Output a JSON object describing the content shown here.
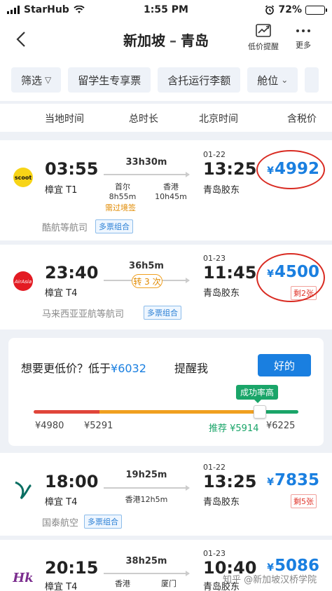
{
  "status_bar": {
    "carrier": "StarHub",
    "time": "1:55 PM",
    "battery": "72%",
    "battery_level": 0.72
  },
  "nav": {
    "origin": "新加坡",
    "separator": "–",
    "destination": "青岛",
    "price_alert_label": "低价提醒",
    "more_label": "更多"
  },
  "filters": [
    "筛选",
    "留学生专享票",
    "含托运行李额",
    "舱位"
  ],
  "columns": {
    "local_time": "当地时间",
    "duration": "总时长",
    "beijing_time": "北京时间",
    "price_incl_tax": "含税价"
  },
  "flights": [
    {
      "logo_text": "scoot",
      "dep_time": "03:55",
      "dep_airport": "樟宜 T1",
      "duration": "33h30m",
      "stops": [
        {
          "city": "首尔",
          "wait": "8h55m"
        },
        {
          "city": "香港",
          "wait": "10h45m"
        }
      ],
      "warning": "需过境签",
      "arr_date": "01-22",
      "arr_time": "13:25",
      "arr_airport": "青岛胶东",
      "airline": "酷航等航司",
      "combo": "多票组合",
      "currency": "¥",
      "price": "4992"
    },
    {
      "logo_text": "AirAsia",
      "dep_time": "23:40",
      "dep_airport": "樟宜 T4",
      "duration": "36h5m",
      "transfer": "转 3 次",
      "arr_date": "01-23",
      "arr_time": "11:45",
      "arr_airport": "青岛胶东",
      "airline": "马来西亚亚航等航司",
      "combo": "多票组合",
      "currency": "¥",
      "price": "4500",
      "seats_left": "剩2张"
    },
    {
      "dep_time": "18:00",
      "dep_airport": "樟宜 T4",
      "duration": "19h25m",
      "stop_text": "香港12h5m",
      "arr_date": "01-22",
      "arr_time": "13:25",
      "arr_airport": "青岛胶东",
      "airline": "国泰航空",
      "combo": "多票组合",
      "currency": "¥",
      "price": "7835",
      "seats_left": "剩5张"
    },
    {
      "dep_time": "20:15",
      "dep_airport": "樟宜 T4",
      "duration": "38h25m",
      "stops": [
        {
          "city": "香港"
        },
        {
          "city": "厦门"
        }
      ],
      "arr_date": "01-23",
      "arr_time": "10:40",
      "arr_airport": "青岛胶东",
      "currency": "¥",
      "price": "5086"
    }
  ],
  "price_alert": {
    "text_prefix": "想要更低价？低于",
    "target_price": "¥6032",
    "remind_label": "提醒我",
    "ok_button": "好的",
    "success_label": "成功率高",
    "ticks": {
      "t1": "¥4980",
      "t2": "¥5291",
      "t3": "推荐 ¥5914",
      "t4": "¥6225"
    },
    "colors": {
      "low": "#e0453a",
      "mid": "#f0a020",
      "high": "#1aa569"
    }
  },
  "watermark": "知乎 @新加坡汉桥学院"
}
